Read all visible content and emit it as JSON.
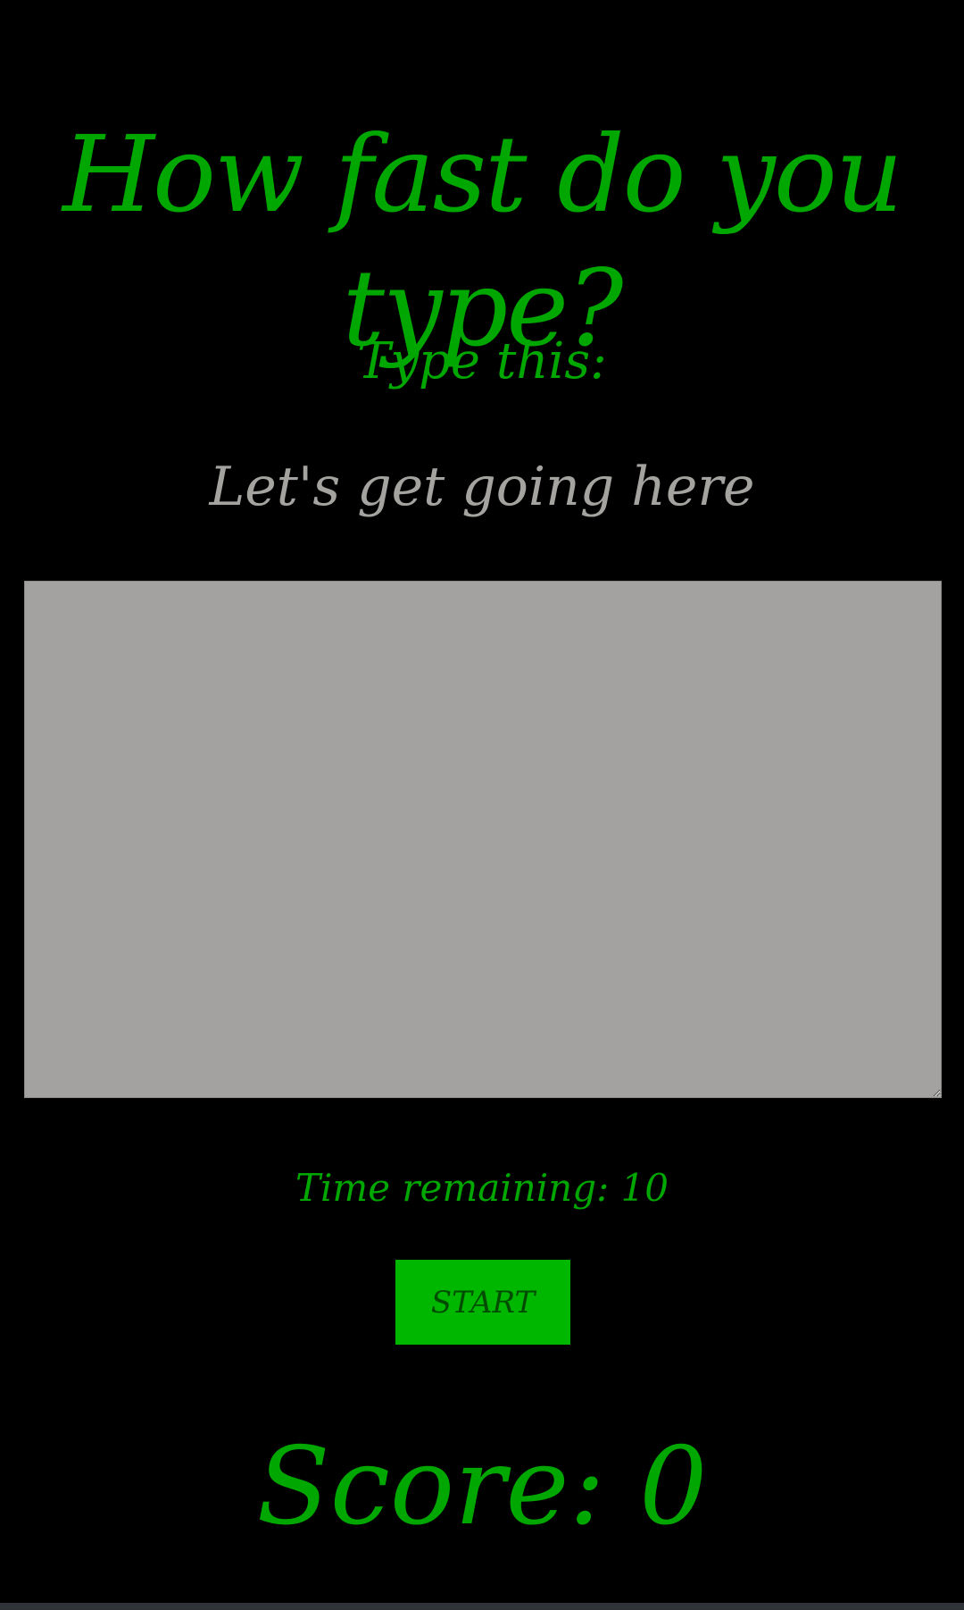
{
  "header": {
    "title": "How fast do you type?"
  },
  "prompt": {
    "label": "Type this:",
    "text": "Let's get going here"
  },
  "typing_area": {
    "value": "",
    "placeholder": ""
  },
  "timer": {
    "text": "Time remaining: 10"
  },
  "controls": {
    "start_label": "START"
  },
  "score": {
    "text": "Score: 0"
  },
  "colors": {
    "background": "#000000",
    "accent_green": "#00a700",
    "button_green": "#00b700",
    "prompt_gray": "#a5a3a0",
    "textarea_gray": "#a3a2a0"
  }
}
